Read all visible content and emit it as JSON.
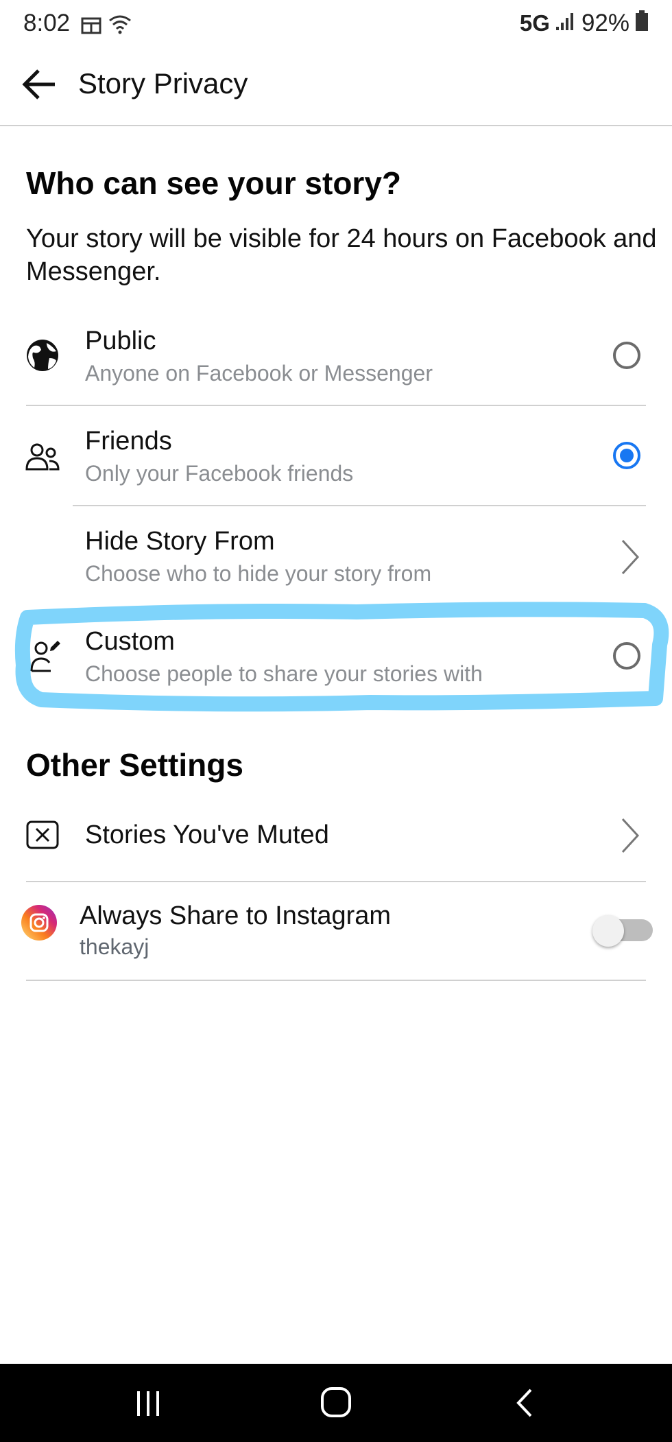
{
  "status_bar": {
    "time": "8:02",
    "network": "5G",
    "battery": "92%"
  },
  "header": {
    "title": "Story Privacy"
  },
  "audience": {
    "heading": "Who can see your story?",
    "description": "Your story will be visible for 24 hours on Facebook and Messenger.",
    "options": [
      {
        "title": "Public",
        "subtitle": "Anyone on Facebook or Messenger",
        "icon": "globe-icon",
        "selected": false
      },
      {
        "title": "Friends",
        "subtitle": "Only your Facebook friends",
        "icon": "friends-icon",
        "selected": true
      },
      {
        "title": "Hide Story From",
        "subtitle": "Choose who to hide your story from",
        "icon": "chevron-right-icon"
      },
      {
        "title": "Custom",
        "subtitle": "Choose people to share your stories with",
        "icon": "custom-person-edit-icon",
        "selected": false
      }
    ]
  },
  "other_settings": {
    "heading": "Other Settings",
    "muted_label": "Stories You've Muted",
    "instagram": {
      "label": "Always Share to Instagram",
      "account": "thekayj",
      "enabled": false
    }
  },
  "colors": {
    "accent": "#1877f2",
    "highlight_annotation": "#7fd4fb",
    "secondary_text": "#8a8d91"
  }
}
